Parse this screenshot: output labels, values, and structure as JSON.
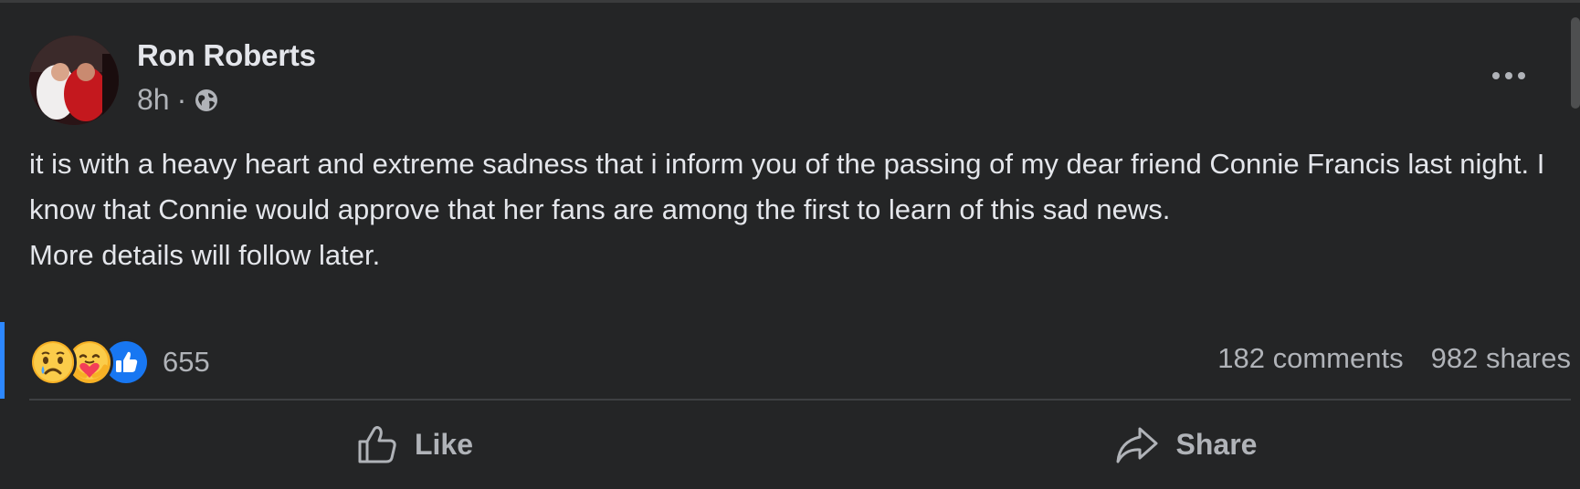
{
  "post": {
    "author": "Ron Roberts",
    "time": "8h",
    "separator": "·",
    "audience_icon": "globe-icon",
    "paragraphs": [
      "it is with a heavy heart and extreme sadness that i inform you of the passing of my dear friend Connie Francis last night. I know that Connie would approve that her fans are among the first to learn of this sad news.",
      "More details will follow later."
    ],
    "reactions": {
      "icons": [
        "sad-reaction-icon",
        "care-reaction-icon",
        "like-reaction-icon"
      ],
      "count": "655"
    },
    "comments": "182 comments",
    "shares": "982 shares"
  },
  "actions": {
    "like_label": "Like",
    "share_label": "Share"
  },
  "colors": {
    "background": "#242526",
    "text": "#e4e6eb",
    "secondary_text": "#b0b3b8",
    "accent": "#2d88ff"
  }
}
